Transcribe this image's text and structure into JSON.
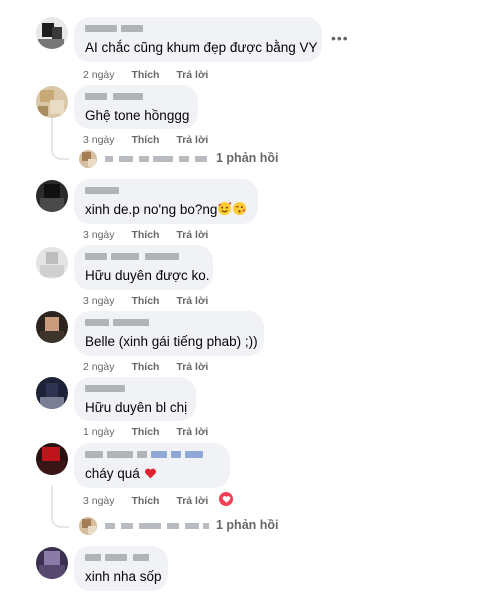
{
  "comments": [
    {
      "text": "AI chắc cũng khum đẹp được bằng VY",
      "time": "2 ngày",
      "like": "Thích",
      "reply": "Trả lời"
    },
    {
      "text": "Ghệ tone hồnggg",
      "time": "3 ngày",
      "like": "Thích",
      "reply": "Trả lời",
      "replies": "1 phản hồi"
    },
    {
      "text": "xinh de.p no'ng bo?ng",
      "time": "3 ngày",
      "like": "Thích",
      "reply": "Trả lời"
    },
    {
      "text": "Hữu duyên được ko.",
      "time": "3 ngày",
      "like": "Thích",
      "reply": "Trả lời"
    },
    {
      "text": "Belle (xinh gái tiếng phab) ;))",
      "time": "2 ngày",
      "like": "Thích",
      "reply": "Trả lời"
    },
    {
      "text": "Hữu duyên bl chị",
      "time": "1 ngày",
      "like": "Thích",
      "reply": "Trả lời"
    },
    {
      "text": "cháy quá",
      "time": "3 ngày",
      "like": "Thích",
      "reply": "Trả lời",
      "replies": "1 phản hồi"
    },
    {
      "text": "xinh nha sốp"
    }
  ],
  "more_icon": "•••",
  "colors": {
    "bubble": "#f0f2f5",
    "meta": "#65676b",
    "heart": "#f33e58"
  },
  "icons": [
    "more-options-icon",
    "heart-reaction-icon",
    "smiling-face-with-hearts-emoji",
    "face-blowing-kiss-emoji",
    "red-heart-emoji"
  ]
}
